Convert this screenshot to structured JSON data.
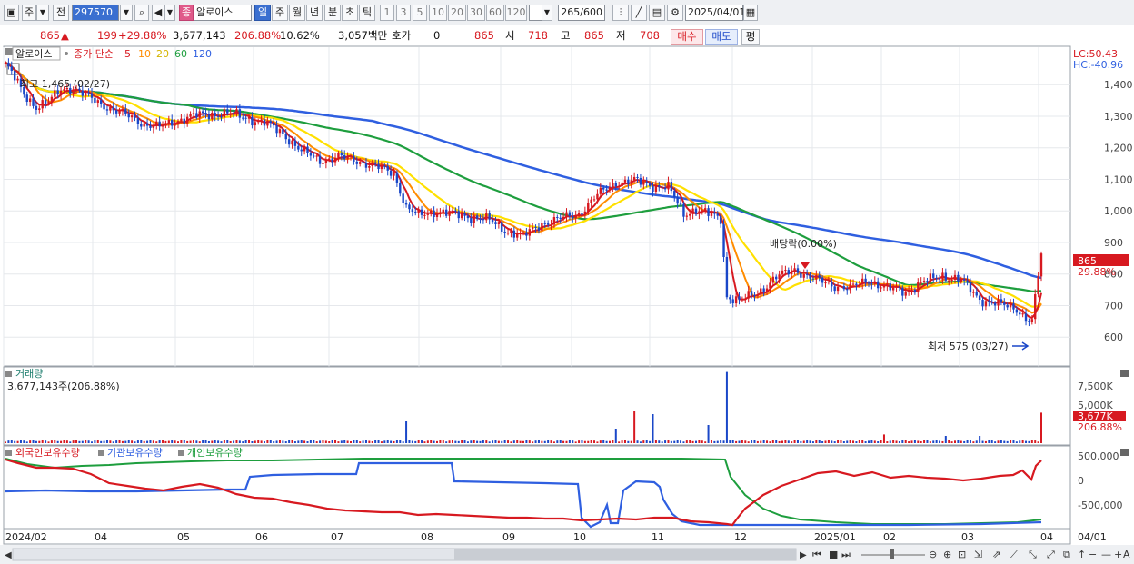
{
  "toolbar": {
    "period_type": "주",
    "prev_label": "전",
    "code": "297570",
    "stock_name": "알로이스",
    "stock_badge": "종",
    "timeframes": [
      "일",
      "주",
      "월",
      "년",
      "분",
      "초",
      "틱"
    ],
    "timeframe_active": "일",
    "intervals": [
      "1",
      "3",
      "5",
      "10",
      "20",
      "30",
      "60",
      "120"
    ],
    "count": "265",
    "count_total": "/600",
    "date": "2025/04/01"
  },
  "quote": {
    "price": "865",
    "change": "199",
    "change_pct": "+29.88%",
    "volume": "3,677,143",
    "volume_ratio": "206.88%",
    "turnover": "10.62%",
    "amount": "3,057백만",
    "hoga_label": "호가",
    "hoga_value": "0",
    "hoga_price": "865",
    "open_label": "시",
    "open": "718",
    "high_label": "고",
    "high": "865",
    "low_label": "저",
    "low": "708",
    "buy_label": "매수",
    "sell_label": "매도",
    "eval_label": "평"
  },
  "chart_data": {
    "type": "candlestick",
    "legend": {
      "name": "알로이스",
      "price_label": "종가 단순",
      "ma_periods": [
        "5",
        "10",
        "20",
        "60",
        "120"
      ],
      "ma_colors": [
        "#d71920",
        "#ff8c00",
        "#ffe000",
        "#1e9e3e",
        "#2f5fe0"
      ]
    },
    "lc": "LC:50.43",
    "hc": "HC:-40.96",
    "price_axis": [
      "1,400",
      "1,300",
      "1,200",
      "1,100",
      "1,000",
      "900",
      "800",
      "700",
      "600"
    ],
    "ylim": [
      520,
      1510
    ],
    "last_price_label": "865",
    "last_pct_label": "29.88%",
    "annotations": {
      "high": "최고 1,465 (02/27)",
      "low": "최저 575 (03/27)",
      "dividend": "배당락(0.00%)"
    },
    "x_labels": [
      "2024/02",
      "04",
      "05",
      "06",
      "07",
      "08",
      "09",
      "10",
      "11",
      "12",
      "2025/01",
      "02",
      "03",
      "04",
      "04/01"
    ],
    "price_path": [
      [
        0,
        1465
      ],
      [
        3,
        1420
      ],
      [
        6,
        1370
      ],
      [
        10,
        1330
      ],
      [
        14,
        1345
      ],
      [
        18,
        1385
      ],
      [
        22,
        1390
      ],
      [
        26,
        1365
      ],
      [
        30,
        1345
      ],
      [
        35,
        1320
      ],
      [
        40,
        1300
      ],
      [
        45,
        1275
      ],
      [
        50,
        1265
      ],
      [
        55,
        1285
      ],
      [
        60,
        1300
      ],
      [
        66,
        1305
      ],
      [
        72,
        1310
      ],
      [
        78,
        1295
      ],
      [
        84,
        1280
      ],
      [
        90,
        1245
      ],
      [
        96,
        1190
      ],
      [
        102,
        1160
      ],
      [
        108,
        1170
      ],
      [
        114,
        1160
      ],
      [
        120,
        1140
      ],
      [
        126,
        1120
      ],
      [
        130,
        1010
      ],
      [
        134,
        985
      ],
      [
        140,
        1000
      ],
      [
        148,
        985
      ],
      [
        156,
        975
      ],
      [
        162,
        940
      ],
      [
        168,
        920
      ],
      [
        174,
        960
      ],
      [
        180,
        975
      ],
      [
        186,
        990
      ],
      [
        192,
        1050
      ],
      [
        198,
        1090
      ],
      [
        204,
        1095
      ],
      [
        210,
        1080
      ],
      [
        215,
        1075
      ],
      [
        220,
        990
      ],
      [
        224,
        1005
      ],
      [
        228,
        990
      ],
      [
        232,
        975
      ],
      [
        234,
        730
      ],
      [
        238,
        715
      ],
      [
        244,
        740
      ],
      [
        250,
        790
      ],
      [
        256,
        815
      ],
      [
        262,
        785
      ],
      [
        268,
        765
      ],
      [
        274,
        755
      ],
      [
        280,
        780
      ],
      [
        286,
        755
      ],
      [
        292,
        745
      ],
      [
        298,
        775
      ],
      [
        304,
        795
      ],
      [
        310,
        780
      ],
      [
        316,
        720
      ],
      [
        322,
        705
      ],
      [
        328,
        690
      ],
      [
        331,
        660
      ],
      [
        333,
        650
      ],
      [
        336,
        865
      ]
    ],
    "volume": {
      "title": "거래량",
      "label": "3,677,143주(206.88%)",
      "axis": [
        "7,500K",
        "5,000K"
      ],
      "last_label": "3,677K",
      "last_pct": "206.88%"
    },
    "holdings": {
      "series": [
        "외국인보유수량",
        "기관보유수량",
        "개인보유수량"
      ],
      "axis": [
        "500,000",
        "0",
        "-500,000"
      ]
    }
  }
}
